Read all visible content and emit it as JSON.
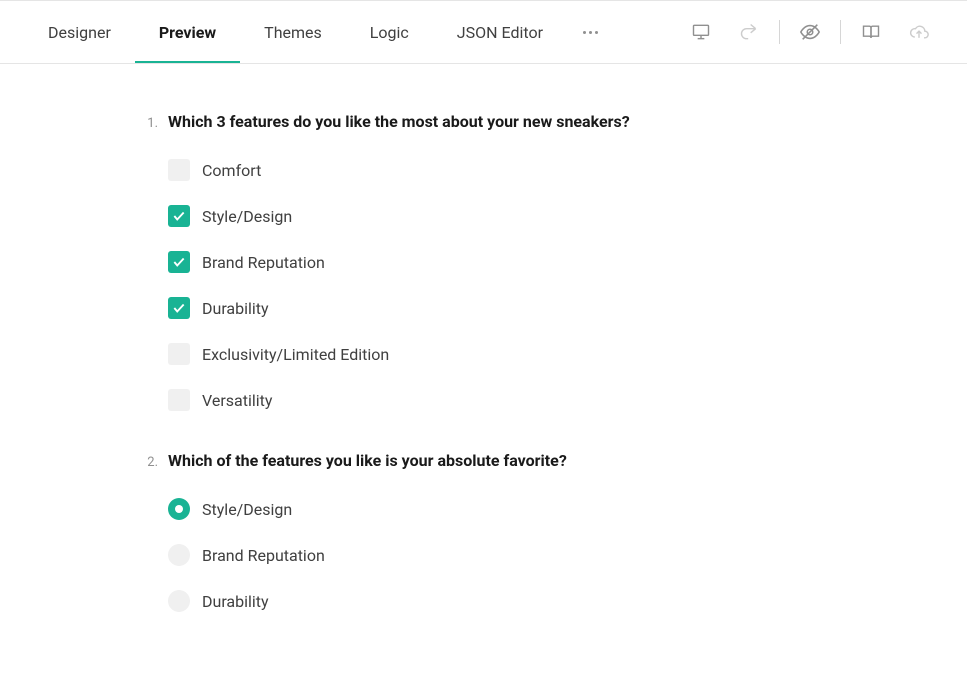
{
  "tabs": {
    "designer": "Designer",
    "preview": "Preview",
    "themes": "Themes",
    "logic": "Logic",
    "json_editor": "JSON Editor",
    "active": "preview"
  },
  "colors": {
    "accent": "#19b394"
  },
  "questions": [
    {
      "number": "1.",
      "title": "Which 3 features do you like the most about your new sneakers?",
      "type": "checkbox",
      "options": [
        {
          "label": "Comfort",
          "checked": false
        },
        {
          "label": "Style/Design",
          "checked": true
        },
        {
          "label": "Brand Reputation",
          "checked": true
        },
        {
          "label": "Durability",
          "checked": true
        },
        {
          "label": "Exclusivity/Limited Edition",
          "checked": false
        },
        {
          "label": "Versatility",
          "checked": false
        }
      ]
    },
    {
      "number": "2.",
      "title": "Which of the features you like is your absolute favorite?",
      "type": "radio",
      "options": [
        {
          "label": "Style/Design",
          "selected": true
        },
        {
          "label": "Brand Reputation",
          "selected": false
        },
        {
          "label": "Durability",
          "selected": false
        }
      ]
    }
  ]
}
